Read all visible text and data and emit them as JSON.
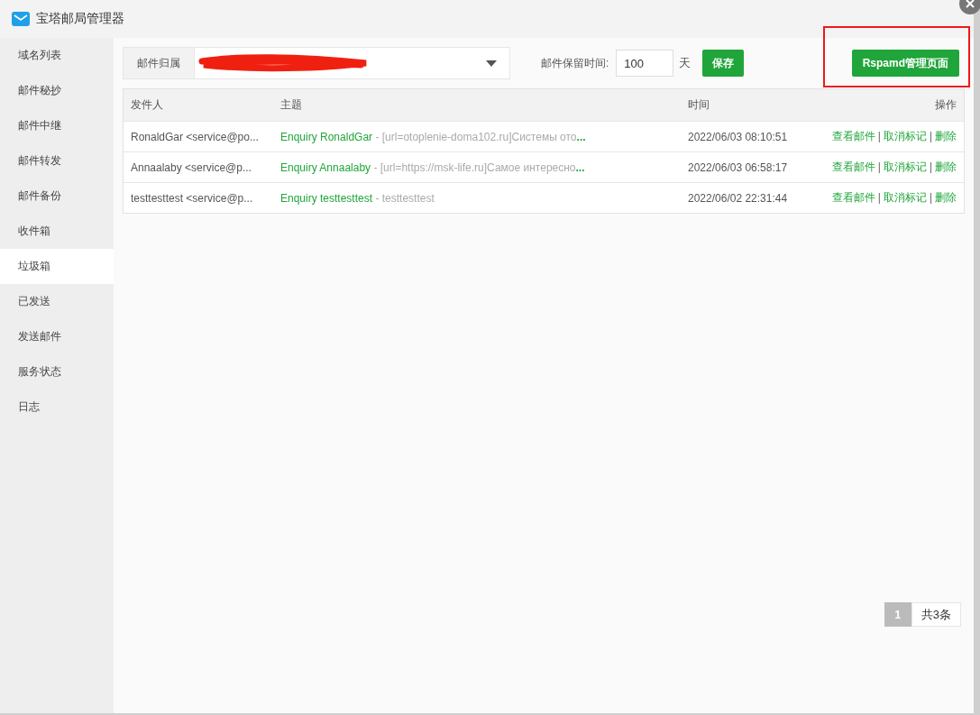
{
  "window": {
    "title": "宝塔邮局管理器"
  },
  "sidebar": {
    "items": [
      {
        "label": "域名列表",
        "selected": false
      },
      {
        "label": "邮件秘抄",
        "selected": false
      },
      {
        "label": "邮件中继",
        "selected": false
      },
      {
        "label": "邮件转发",
        "selected": false
      },
      {
        "label": "邮件备份",
        "selected": false
      },
      {
        "label": "收件箱",
        "selected": false
      },
      {
        "label": "垃圾箱",
        "selected": true
      },
      {
        "label": "已发送",
        "selected": false
      },
      {
        "label": "发送邮件",
        "selected": false
      },
      {
        "label": "服务状态",
        "selected": false
      },
      {
        "label": "日志",
        "selected": false
      }
    ]
  },
  "toolbar": {
    "owner_label": "邮件归属",
    "retention_label": "邮件保留时间:",
    "retention_value": "100",
    "retention_unit": "天",
    "save_button": "保存",
    "rspamd_button": "Rspamd管理页面"
  },
  "table": {
    "columns": [
      "发件人",
      "主题",
      "时间",
      "操作"
    ],
    "rows": [
      {
        "sender": "RonaldGar <service@po...",
        "subject": "Enquiry RonaldGar",
        "preview": " - [url=otoplenie-doma102.ru]Системы ото",
        "more": "...",
        "time": "2022/06/03 08:10:51",
        "actions": [
          {
            "label": "查看邮件"
          },
          {
            "separator": "|",
            "label": "取消标记"
          },
          {
            "separator": "|",
            "label": "删除"
          }
        ]
      },
      {
        "sender": "Annaalaby <service@p...",
        "subject": "Enquiry Annaalaby",
        "preview": " - [url=https://msk-life.ru]Самое интересно",
        "more": "...",
        "time": "2022/06/03 06:58:17",
        "actions": [
          {
            "label": "查看邮件"
          },
          {
            "separator": "|",
            "label": "取消标记"
          },
          {
            "separator": "|",
            "label": "删除"
          }
        ]
      },
      {
        "sender": "testtesttest <service@p...",
        "subject": "Enquiry testtesttest",
        "preview": " - testtesttest",
        "time": "2022/06/02 22:31:44",
        "actions": [
          {
            "label": "查看邮件"
          },
          {
            "separator": "|",
            "label": "取消标记"
          },
          {
            "separator": "|",
            "label": "删除"
          }
        ]
      }
    ]
  },
  "pagination": {
    "pages": [
      {
        "label": "1",
        "selected": true
      }
    ],
    "total": "共3条"
  }
}
